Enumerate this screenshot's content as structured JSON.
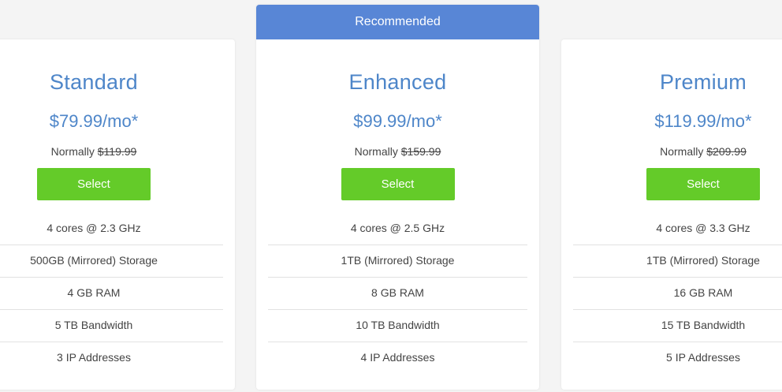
{
  "recommended_label": "Recommended",
  "plans": [
    {
      "name": "Standard",
      "price": "$79.99/mo*",
      "normally_label": "Normally",
      "normally_price": "$119.99",
      "select_label": "Select",
      "features": [
        "4 cores @ 2.3 GHz",
        "500GB (Mirrored) Storage",
        "4 GB RAM",
        "5 TB Bandwidth",
        "3 IP Addresses"
      ]
    },
    {
      "name": "Enhanced",
      "price": "$99.99/mo*",
      "normally_label": "Normally",
      "normally_price": "$159.99",
      "select_label": "Select",
      "features": [
        "4 cores @ 2.5 GHz",
        "1TB (Mirrored) Storage",
        "8 GB RAM",
        "10 TB Bandwidth",
        "4 IP Addresses"
      ]
    },
    {
      "name": "Premium",
      "price": "$119.99/mo*",
      "normally_label": "Normally",
      "normally_price": "$209.99",
      "select_label": "Select",
      "features": [
        "4 cores @ 3.3 GHz",
        "1TB (Mirrored) Storage",
        "16 GB RAM",
        "15 TB Bandwidth",
        "5 IP Addresses"
      ]
    }
  ],
  "colors": {
    "accent_blue": "#4e86c9",
    "ribbon_blue": "#5886d6",
    "select_green": "#64cb29",
    "background": "#f4f4f4"
  }
}
